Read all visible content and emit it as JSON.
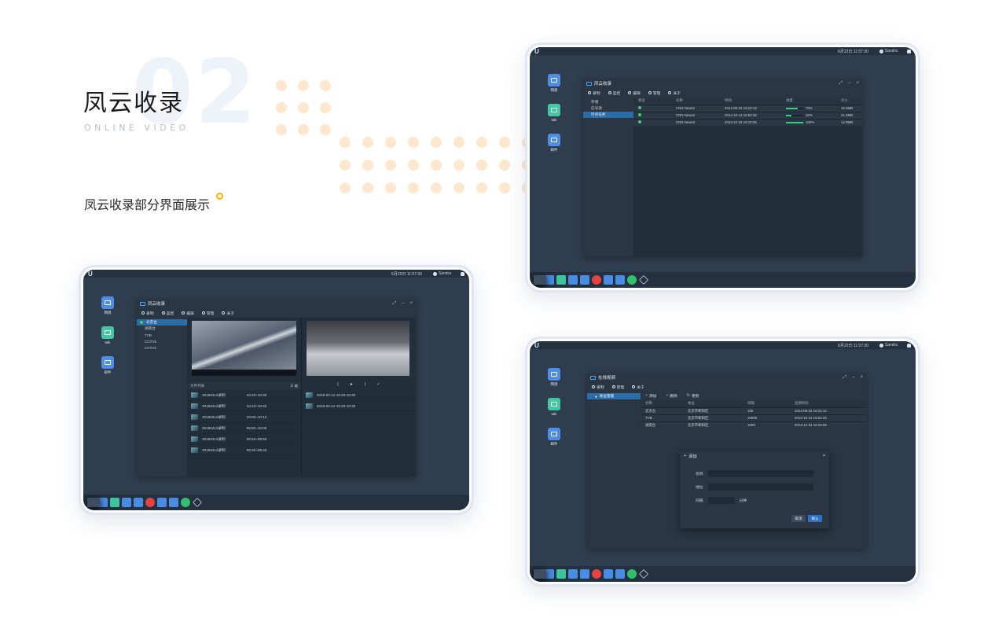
{
  "header": {
    "big_number": "02",
    "title": "凤云收录",
    "subtitle": "ONLINE VIDEO",
    "description": "凤云收录部分界面展示"
  },
  "colors": {
    "accent_ring": "#f4b400",
    "dots": "#fde7cf",
    "screen_bg": "#2f3e4f",
    "active_blue": "#2c6ca7",
    "progress_green": "#2fd37a"
  },
  "system": {
    "logo": "U",
    "clock": "6月22日 11:57:30",
    "user": "Sandra"
  },
  "desktop_icons": [
    {
      "label": "网盘",
      "icon": "cloud-drive-icon"
    },
    {
      "label": "talk",
      "icon": "chat-icon"
    },
    {
      "label": "邮件",
      "icon": "mail-icon"
    }
  ],
  "toolbar_main": [
    "录制",
    "监控",
    "编辑",
    "管理",
    "关于"
  ],
  "toolbar_online": [
    "录制",
    "管理",
    "关于"
  ],
  "window_monitor": {
    "title": "凤云收录",
    "sidebar": [
      "存储",
      "信号源",
      "行点任务"
    ],
    "active_index": 2,
    "columns": [
      "状态",
      "名称",
      "时间",
      "进度",
      "大小"
    ],
    "rows": [
      {
        "name": "CNN News1",
        "time": "2014-06-22 15:22:12",
        "progress": 70,
        "progress_text": "70%",
        "size": "10.5MB"
      },
      {
        "name": "CNN News2",
        "time": "2014-10-13 15:52:32",
        "progress": 32,
        "progress_text": "32%",
        "size": "21.6MB"
      },
      {
        "name": "CNN News3",
        "time": "2014-12-24 16:15:05",
        "progress": 100,
        "progress_text": "100%",
        "size": "12.9MB"
      }
    ]
  },
  "window_record": {
    "title": "凤云收录",
    "channels": [
      "北京台",
      "湖南台",
      "TVB",
      "CCTV5",
      "CCTV1"
    ],
    "list_title": "文件列表",
    "recordings": [
      {
        "name": "20190412录制",
        "time": "10:20~10:30"
      },
      {
        "name": "20190412录制",
        "time": "10:10~10:20"
      },
      {
        "name": "20190412录制",
        "time": "10:00~10:10"
      },
      {
        "name": "20190412录制",
        "time": "09:50~10:00"
      },
      {
        "name": "20190412录制",
        "time": "09:40~09:50"
      },
      {
        "name": "20190412录制",
        "time": "09:30~09:40"
      }
    ],
    "clips": [
      "2019-04-12 10:20-10:30",
      "2019-04-12 10:20-10:30"
    ],
    "controls": [
      "(",
      "►",
      ")",
      "✓"
    ]
  },
  "window_online": {
    "title": "在线视频",
    "sidebar": [
      "地址管理"
    ],
    "actions": [
      "添加",
      "删除",
      "更新"
    ],
    "columns": [
      "名称",
      "地址",
      "间隔",
      "创建时间"
    ],
    "rows": [
      {
        "name": "北京台",
        "addr": "北京市朝阳区",
        "interval": "100",
        "created": "2014-06-22 15:22:12"
      },
      {
        "name": "TVB",
        "addr": "北京市朝阳区",
        "interval": "10000",
        "created": "2014-10-13 15:52:32"
      },
      {
        "name": "湖南台",
        "addr": "北京市朝阳区",
        "interval": "1000",
        "created": "2014-12-24 16:15:05"
      }
    ],
    "dialog": {
      "title": "添加",
      "name_label": "名称",
      "addr_label": "地址",
      "interval_label": "间隔",
      "interval_unit": "分钟",
      "cancel": "取消",
      "confirm": "确认"
    }
  }
}
